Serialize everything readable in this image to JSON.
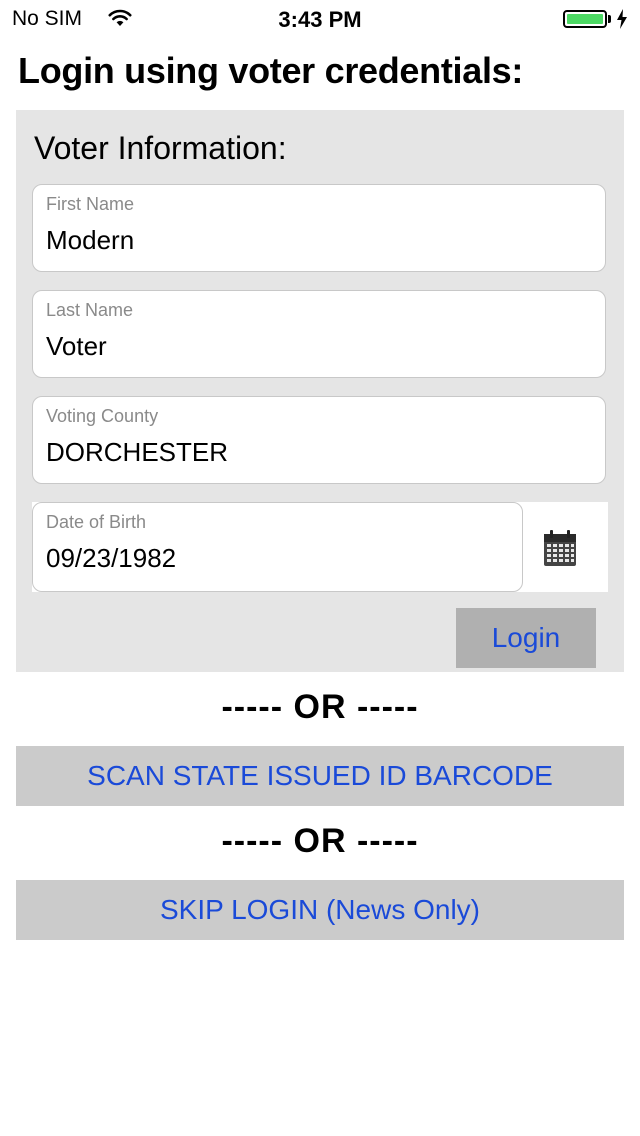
{
  "status_bar": {
    "carrier": "No SIM",
    "time": "3:43 PM",
    "battery_level": 1.0,
    "battery_color": "#4cd964"
  },
  "page_title": "Login using voter credentials:",
  "voter_info": {
    "section_label": "Voter Information:",
    "first_name": {
      "label": "First Name",
      "value": "Modern"
    },
    "last_name": {
      "label": "Last Name",
      "value": "Voter"
    },
    "voting_county": {
      "label": "Voting County",
      "value": "DORCHESTER"
    },
    "date_of_birth": {
      "label": "Date of Birth",
      "value": "09/23/1982"
    },
    "calendar_icon": "calendar-icon",
    "login_label": "Login"
  },
  "divider_1": "----- OR -----",
  "scan_button_label": "SCAN STATE ISSUED ID BARCODE",
  "divider_2": "----- OR -----",
  "skip_button_label": "SKIP LOGIN (News Only)",
  "colors": {
    "panel_bg": "#e5e5e5",
    "button_text": "#1a4ad8",
    "button_bg": "#cbcbcb",
    "login_button_bg": "#b0b0b0"
  }
}
